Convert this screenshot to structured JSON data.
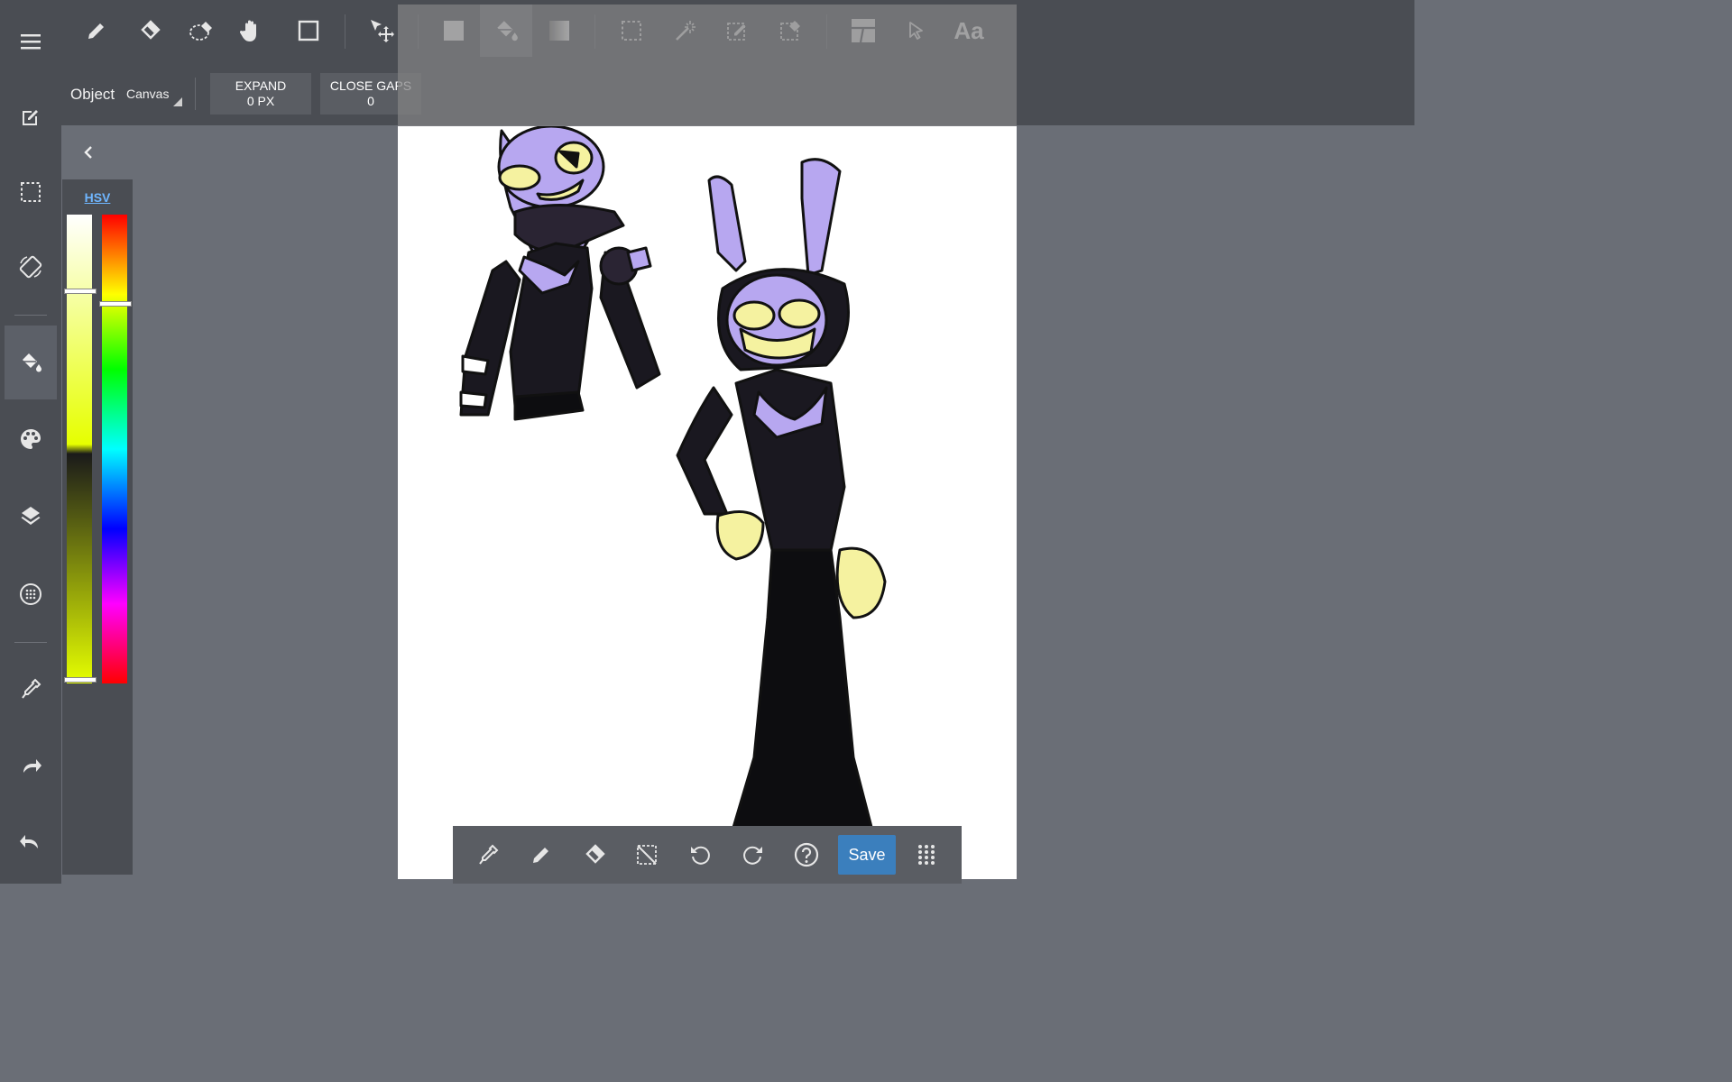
{
  "top_toolbar": {
    "tools": [
      {
        "icon": "pencil-icon"
      },
      {
        "icon": "eraser-icon"
      },
      {
        "icon": "lasso-eraser-icon"
      },
      {
        "icon": "hand-icon"
      },
      {
        "icon": "rectangle-icon"
      },
      {
        "icon": "move-select-icon"
      },
      {
        "icon": "fill-rectangle-icon"
      },
      {
        "icon": "paint-bucket-icon",
        "active": true
      },
      {
        "icon": "gradient-icon"
      },
      {
        "icon": "selection-rectangle-icon"
      },
      {
        "icon": "magic-wand-icon"
      },
      {
        "icon": "selection-pen-icon"
      },
      {
        "icon": "selection-eraser-icon"
      },
      {
        "icon": "frame-divider-icon"
      },
      {
        "icon": "pointer-icon"
      },
      {
        "icon": "text-tool-icon"
      }
    ],
    "text_tool_label": "Aa"
  },
  "options_bar": {
    "object_label": "Object",
    "object_value": "Canvas",
    "expand_title": "EXPAND",
    "expand_value": "0 PX",
    "close_gaps_title": "CLOSE GAPS",
    "close_gaps_value": "0"
  },
  "sidebar": {
    "items": [
      {
        "icon": "menu-icon"
      },
      {
        "icon": "edit-icon"
      },
      {
        "icon": "selection-icon"
      },
      {
        "icon": "rotate-screen-icon"
      },
      {
        "icon": "paint-bucket-icon",
        "active": true
      },
      {
        "icon": "palette-icon"
      },
      {
        "icon": "layers-icon"
      },
      {
        "icon": "texture-icon"
      },
      {
        "icon": "eyedropper-icon"
      },
      {
        "icon": "redo-icon"
      },
      {
        "icon": "undo-icon"
      }
    ]
  },
  "color_panel": {
    "mode_label": "HSV",
    "colors": {
      "saturation_value": "#e6ff00",
      "hue_marker": "#ffffff"
    }
  },
  "bottom_bar": {
    "items": [
      {
        "icon": "eyedropper-icon"
      },
      {
        "icon": "pencil-icon"
      },
      {
        "icon": "eraser-icon"
      },
      {
        "icon": "deselect-icon"
      },
      {
        "icon": "undo-rotate-icon"
      },
      {
        "icon": "redo-rotate-icon"
      },
      {
        "icon": "help-icon"
      }
    ],
    "save_label": "Save",
    "grid_icon": "grid-dots-icon"
  },
  "colors": {
    "toolbar_bg": "#4a4d53",
    "workspace_bg": "#6a6e76",
    "accent": "#3b7fbd",
    "hsv_link": "#6fb6ff",
    "character_purple": "#b7a7f0",
    "character_yellow": "#f5f2a0"
  }
}
